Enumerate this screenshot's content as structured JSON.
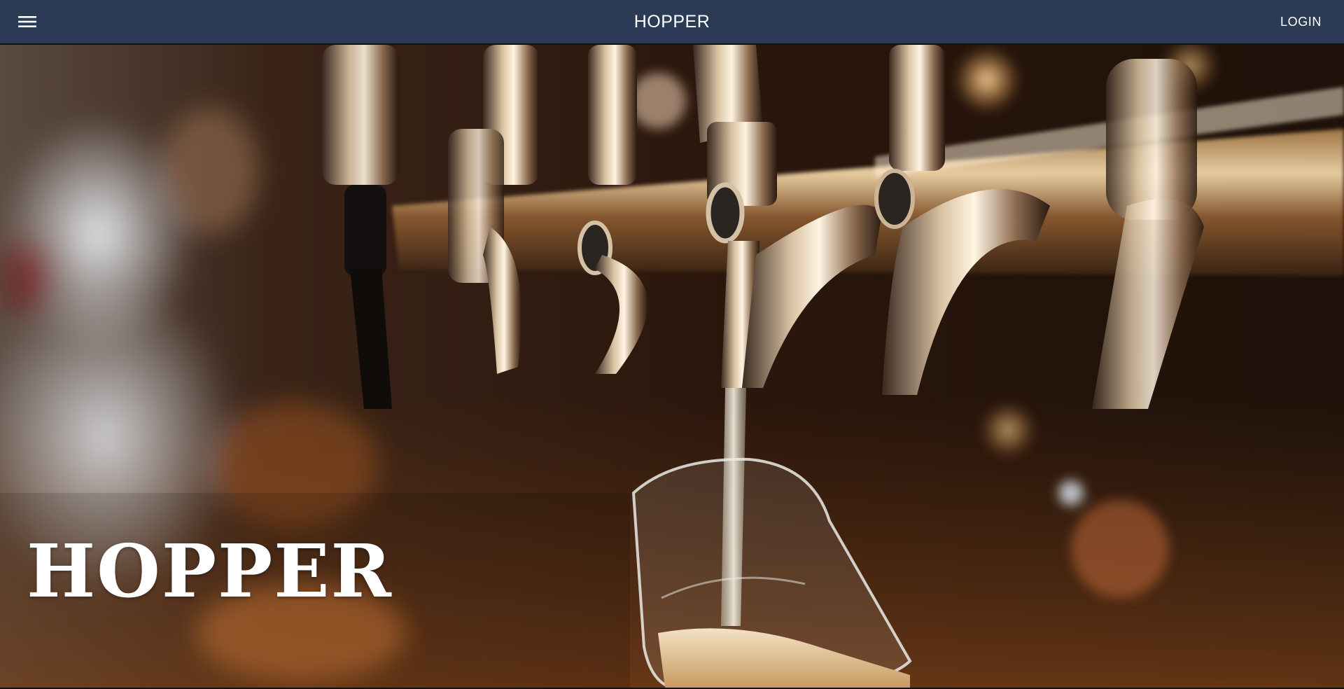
{
  "header": {
    "menu_icon": "hamburger-menu-icon",
    "brand": "HOPPER",
    "login_label": "LOGIN"
  },
  "hero": {
    "title": "HOPPER",
    "image": "beer-taps-pouring-glass-photo"
  },
  "colors": {
    "navbar": "#2b3a55",
    "text": "#ffffff"
  }
}
